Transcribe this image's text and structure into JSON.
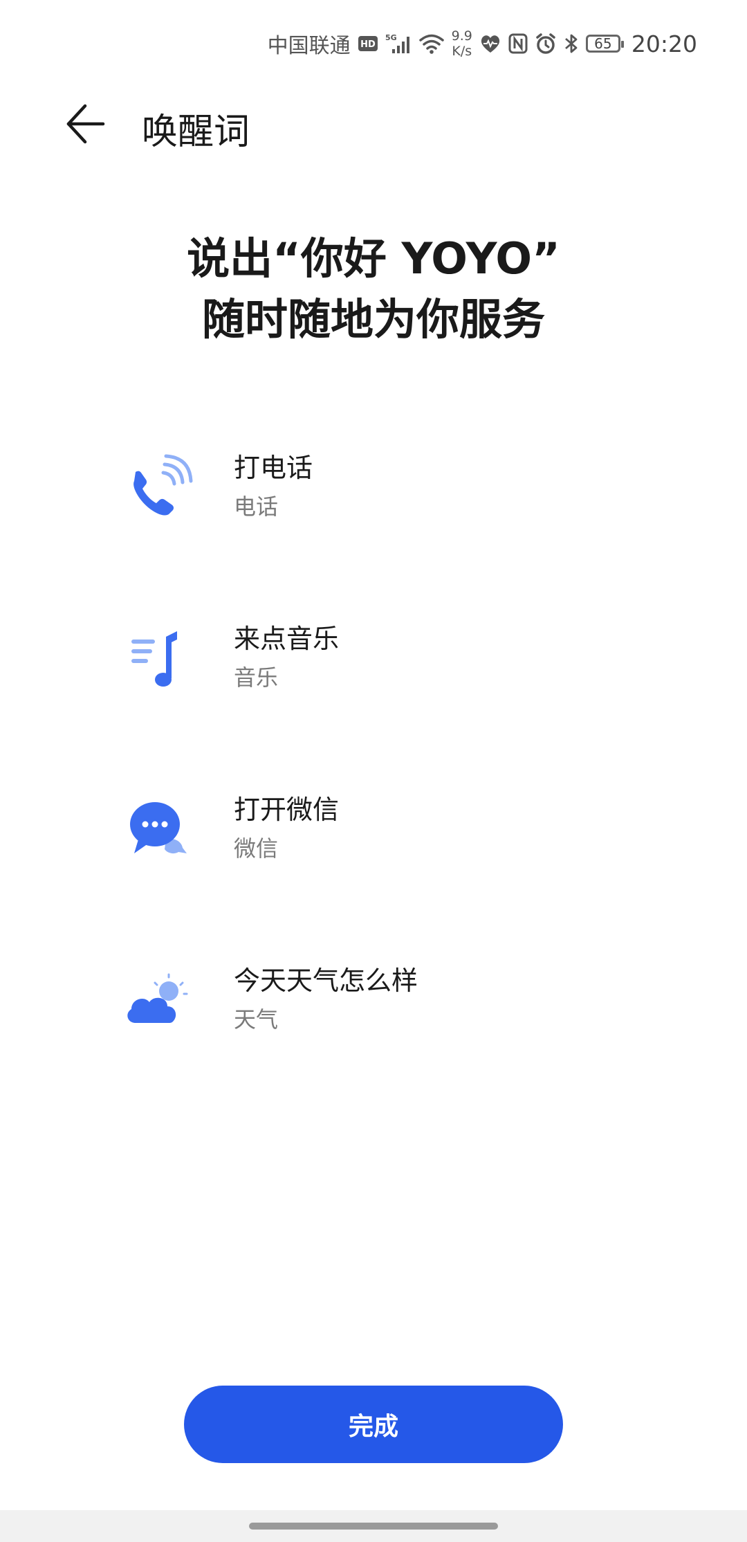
{
  "status_bar": {
    "carrier": "中国联通",
    "hd_badge": "HD",
    "network": "5G",
    "net_speed_value": "9.9",
    "net_speed_unit": "K/s",
    "battery": "65",
    "time": "20:20"
  },
  "header": {
    "title": "唤醒词"
  },
  "headline": {
    "line1": "说出“你好 YOYO”",
    "line2": "随时随地为你服务"
  },
  "commands": [
    {
      "title": "打电话",
      "subtitle": "电话",
      "icon": "phone-call-icon"
    },
    {
      "title": "来点音乐",
      "subtitle": "音乐",
      "icon": "music-note-icon"
    },
    {
      "title": "打开微信",
      "subtitle": "微信",
      "icon": "chat-bubble-icon"
    },
    {
      "title": "今天天气怎么样",
      "subtitle": "天气",
      "icon": "weather-cloud-sun-icon"
    }
  ],
  "footer": {
    "done_label": "完成"
  },
  "colors": {
    "accent": "#2558e8",
    "icon_primary": "#3b6df0",
    "icon_light": "#8fb0f7"
  }
}
